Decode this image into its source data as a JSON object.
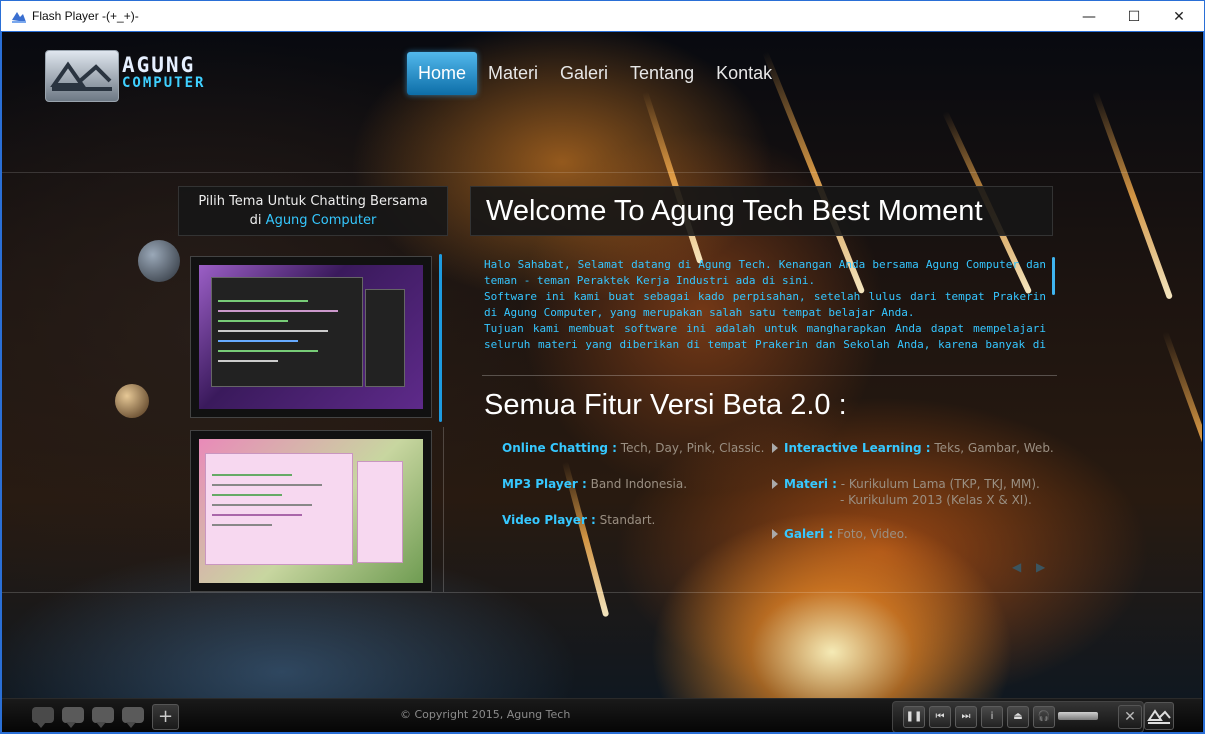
{
  "window": {
    "title": "Flash Player  -(+_+)-",
    "minimize_glyph": "—",
    "maximize_glyph": "☐",
    "close_glyph": "✕"
  },
  "header": {
    "logo_line1": "AGUNG",
    "logo_line2": "COMPUTER",
    "nav": [
      {
        "label": "Home",
        "active": true
      },
      {
        "label": "Materi"
      },
      {
        "label": "Galeri"
      },
      {
        "label": "Tentang"
      },
      {
        "label": "Kontak"
      }
    ]
  },
  "left_panel": {
    "title_line1": "Pilih Tema Untuk Chatting Bersama",
    "title_prefix": "di ",
    "title_highlight": "Agung Computer"
  },
  "welcome": {
    "title": "Welcome To Agung Tech Best Moment",
    "paragraphs": [
      "Halo Sahabat, Selamat datang di Agung Tech. Kenangan Anda bersama Agung Computer dan teman - teman Peraktek Kerja Industri ada di sini.",
      "Software ini kami buat sebagai kado perpisahan, setelah lulus dari tempat Prakerin di Agung Computer, yang merupakan salah satu tempat belajar Anda.",
      "Tujuan kami membuat software ini adalah untuk mangharapkan Anda dapat mempelajari seluruh materi yang diberikan di tempat Prakerin dan Sekolah Anda, karena banyak di antara kalian yang"
    ]
  },
  "features": {
    "title": "Semua Fitur Versi Beta 2.0 :",
    "left": [
      {
        "key": "Online Chatting :",
        "value": " Tech, Day, Pink, Classic."
      },
      {
        "key": "MP3 Player :",
        "value": " Band Indonesia."
      },
      {
        "key": "Video Player :",
        "value": " Standart."
      }
    ],
    "right": [
      {
        "key": "Interactive Learning :",
        "value": " Teks, Gambar, Web.",
        "line2": ""
      },
      {
        "key": "Materi :",
        "value": " - Kurikulum Lama (TKP, TKJ, MM).",
        "line2": "- Kurikulum 2013 (Kelas X & XI)."
      },
      {
        "key": "Galeri :",
        "value": " Foto, Video.",
        "line2": ""
      }
    ],
    "pager_prev": "◀",
    "pager_next": "▶"
  },
  "footer": {
    "copyright": "© Copyright 2015, Agung Tech",
    "plus_label": "+",
    "close_label": "✕",
    "player": {
      "pause": "❚❚",
      "prev": "⏮",
      "next": "⏭",
      "info": "i",
      "eject": "⏏",
      "headphones": "🎧"
    }
  },
  "colors": {
    "accent": "#35c8ff",
    "window_border": "#2a6fd6"
  }
}
